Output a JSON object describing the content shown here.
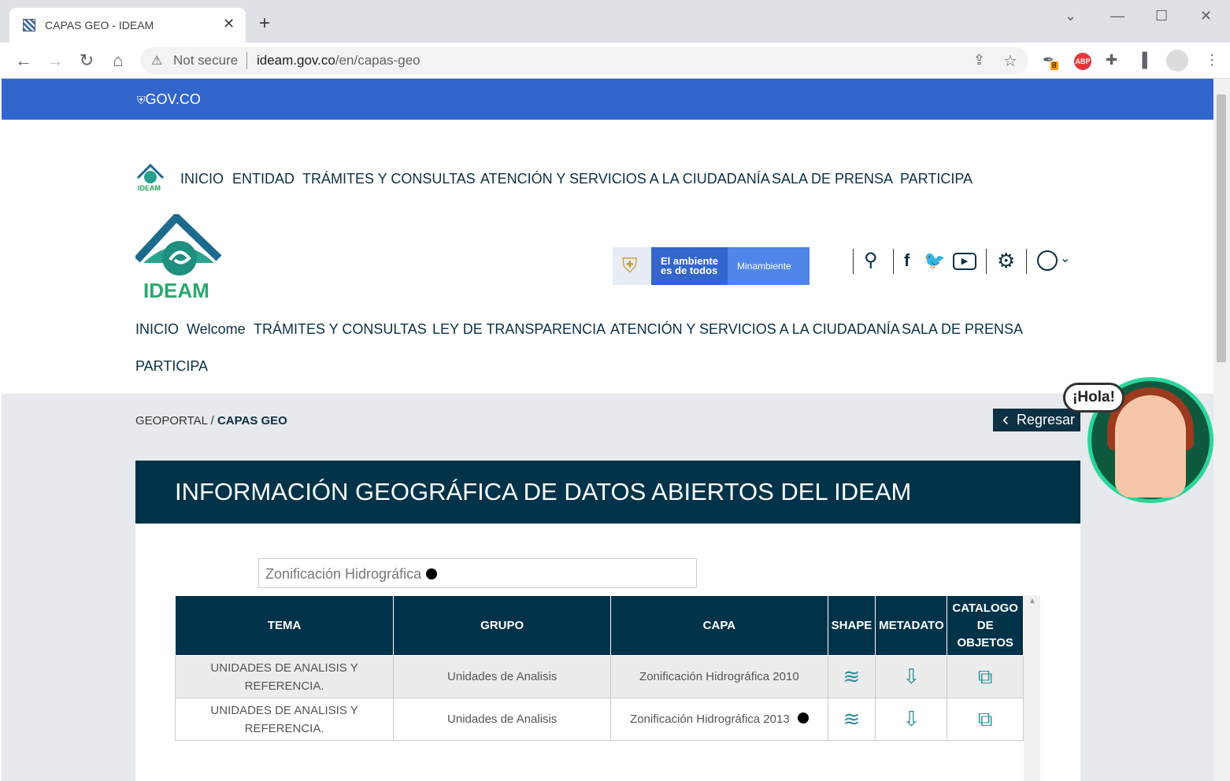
{
  "browser": {
    "tab_title": "CAPAS GEO - IDEAM",
    "security": "Not secure",
    "url_domain": "ideam.gov.co",
    "url_path": "/en/capas-geo",
    "ext_badge": "8",
    "abp": "ABP"
  },
  "gov_bar": {
    "label": "GOV.CO"
  },
  "top_nav": [
    "INICIO",
    "ENTIDAD",
    "TRÁMITES Y CONSULTAS",
    "ATENCIÓN Y SERVICIOS A LA CIUDADANÍA",
    "SALA DE PRENSA",
    "PARTICIPA"
  ],
  "logo": {
    "small": "IDEAM",
    "big": "IDEAM"
  },
  "minambiente": {
    "line1": "El ambiente",
    "line2": "es de todos",
    "brand": "Minambiente"
  },
  "main_nav": [
    "INICIO",
    "Welcome",
    "TRÁMITES Y CONSULTAS",
    "LEY DE TRANSPARENCIA",
    "ATENCIÓN Y SERVICIOS A LA CIUDADANÍA",
    "SALA DE PRENSA",
    "PARTICIPA"
  ],
  "breadcrumb": {
    "parent": "GEOPORTAL",
    "sep": "/",
    "current": "CAPAS GEO"
  },
  "back_button": "Regresar",
  "banner_title": "INFORMACIÓN GEOGRÁFICA DE DATOS ABIERTOS DEL IDEAM",
  "filter_value": "Zonificación Hidrográfica",
  "table": {
    "headers": [
      "TEMA",
      "GRUPO",
      "CAPA",
      "SHAPE",
      "METADATO",
      "CATALOGO DE OBJETOS"
    ],
    "rows": [
      {
        "tema": "UNIDADES DE ANALISIS Y REFERENCIA.",
        "grupo": "Unidades de Analisis",
        "capa": "Zonificación Hidrográfica 2010"
      },
      {
        "tema": "UNIDADES DE ANALISIS Y REFERENCIA.",
        "grupo": "Unidades de Analisis",
        "capa": "Zonificación Hidrográfica 2013"
      }
    ]
  },
  "chat_bubble": "¡Hola!"
}
